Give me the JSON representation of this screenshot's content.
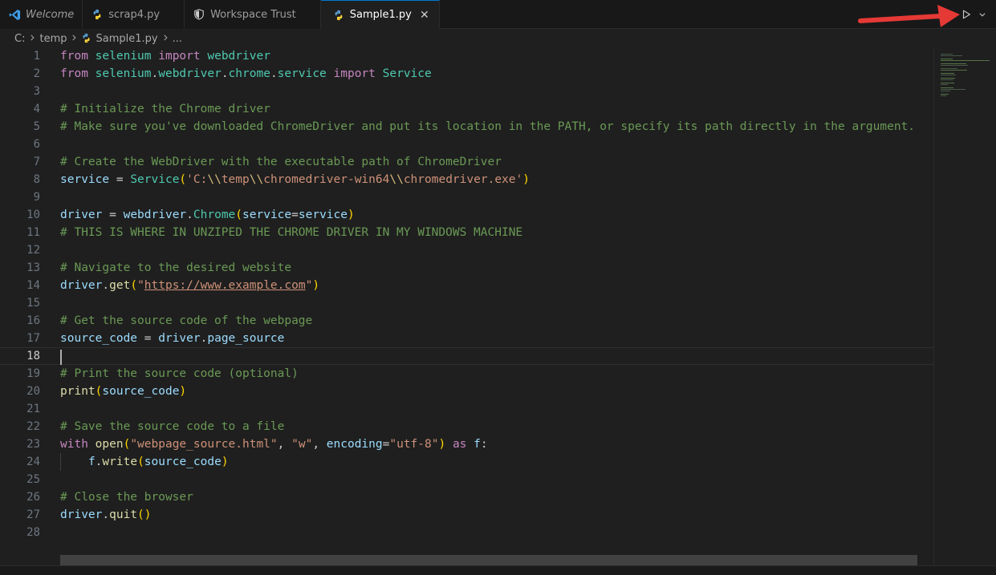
{
  "tabs": [
    {
      "label": "Welcome",
      "icon": "vscode-logo-icon",
      "italic": true,
      "active": false
    },
    {
      "label": "scrap4.py",
      "icon": "python-icon",
      "italic": false,
      "active": false
    },
    {
      "label": "Workspace Trust",
      "icon": "shield-icon",
      "italic": false,
      "active": false
    },
    {
      "label": "Sample1.py",
      "icon": "python-icon",
      "italic": false,
      "active": true
    }
  ],
  "tab_close_glyph": "✕",
  "tab_actions": {
    "run_icon": "run-play-icon",
    "dropdown_icon": "chevron-down-icon"
  },
  "breadcrumb": {
    "drive": "C:",
    "folder": "temp",
    "file": "Sample1.py",
    "more": "..."
  },
  "editor": {
    "current_line": 18,
    "line_numbers": [
      "1",
      "2",
      "3",
      "4",
      "5",
      "6",
      "7",
      "8",
      "9",
      "10",
      "11",
      "12",
      "13",
      "14",
      "15",
      "16",
      "17",
      "18",
      "19",
      "20",
      "21",
      "22",
      "23",
      "24",
      "25",
      "26",
      "27",
      "28"
    ],
    "lines": [
      "from selenium import webdriver",
      "from selenium.webdriver.chrome.service import Service",
      "",
      "# Initialize the Chrome driver",
      "# Make sure you've downloaded ChromeDriver and put its location in the PATH, or specify its path directly in the argument.",
      "",
      "# Create the WebDriver with the executable path of ChromeDriver",
      "service = Service('C:\\\\temp\\\\chromedriver-win64\\\\chromedriver.exe')",
      "",
      "driver = webdriver.Chrome(service=service)",
      "# THIS IS WHERE IN UNZIPED THE CHROME DRIVER IN MY WINDOWS MACHINE",
      "",
      "# Navigate to the desired website",
      "driver.get(\"https://www.example.com\")",
      "",
      "# Get the source code of the webpage",
      "source_code = driver.page_source",
      "",
      "# Print the source code (optional)",
      "print(source_code)",
      "",
      "# Save the source code to a file",
      "with open(\"webpage_source.html\", \"w\", encoding=\"utf-8\") as f:",
      "    f.write(source_code)",
      "",
      "# Close the browser",
      "driver.quit()",
      ""
    ]
  },
  "colors": {
    "keyword": "#c586c0",
    "module": "#4ec9b0",
    "variable": "#9cdcfe",
    "function": "#dcdcaa",
    "string": "#ce9178",
    "comment": "#6a9955",
    "bracket": "#ffd700",
    "active_tab_border": "#0078d4",
    "arrow": "#e53935"
  }
}
